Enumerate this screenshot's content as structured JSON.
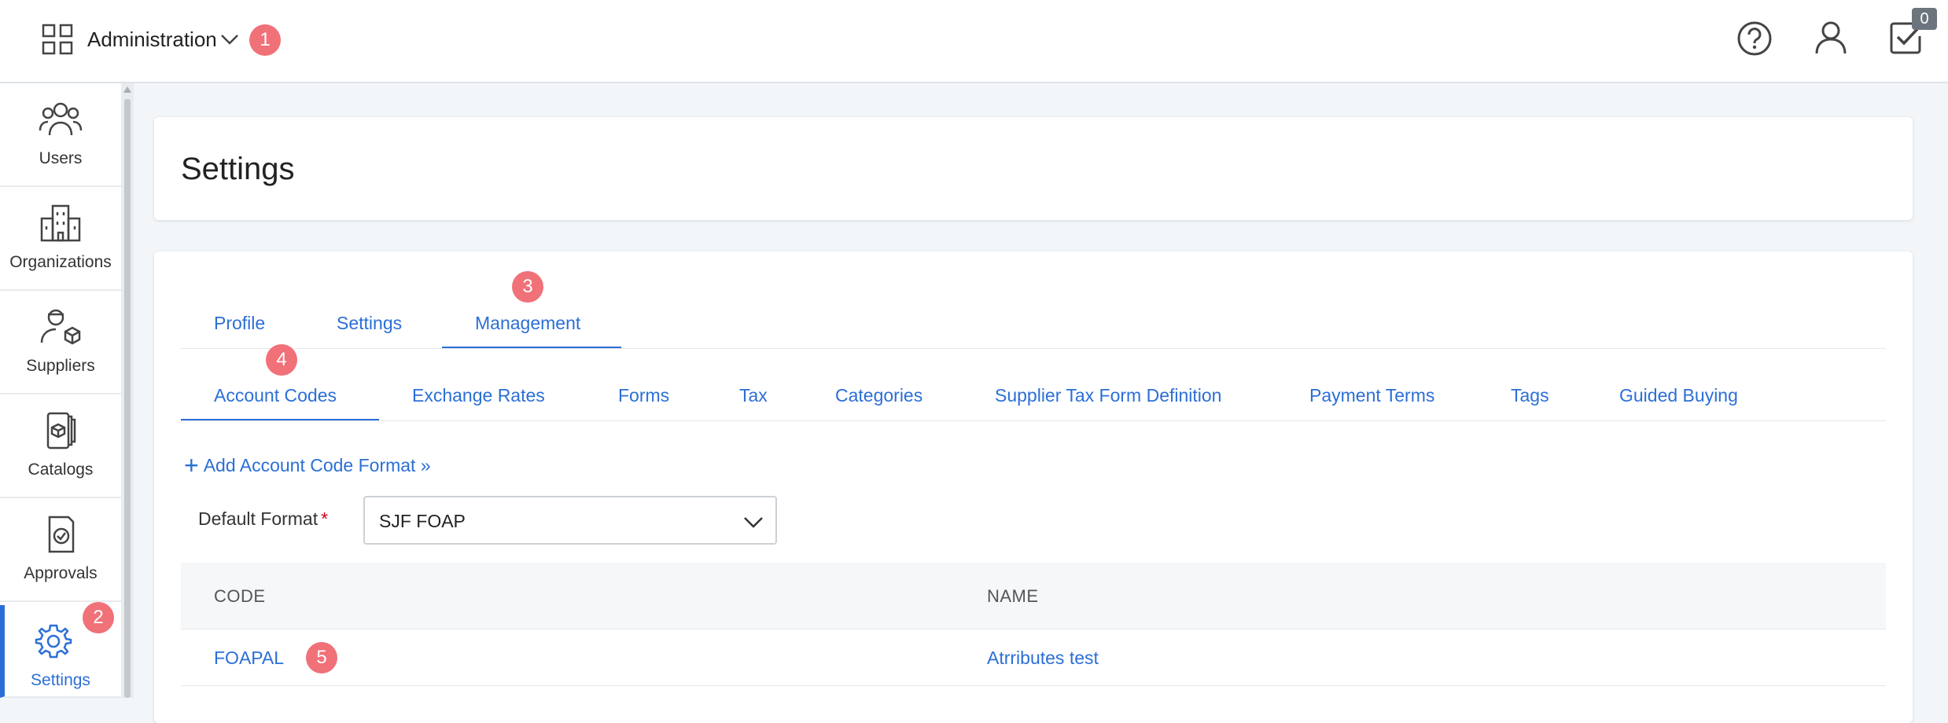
{
  "header": {
    "module_title": "Administration",
    "tasks_count": "0",
    "icons": [
      "grid-icon",
      "chevron-down-icon",
      "help-icon",
      "user-icon",
      "tasks-icon"
    ]
  },
  "badges": [
    "1",
    "2",
    "3",
    "4",
    "5"
  ],
  "sidebar": {
    "items": [
      {
        "label": "Users",
        "icon": "users-icon"
      },
      {
        "label": "Organizations",
        "icon": "building-icon"
      },
      {
        "label": "Suppliers",
        "icon": "supplier-icon"
      },
      {
        "label": "Catalogs",
        "icon": "catalog-icon"
      },
      {
        "label": "Approvals",
        "icon": "approval-icon"
      },
      {
        "label": "Settings",
        "icon": "gear-icon",
        "active": true
      }
    ]
  },
  "page": {
    "title": "Settings"
  },
  "tabs": {
    "primary": [
      "Profile",
      "Settings",
      "Management"
    ],
    "primary_active": "Management",
    "secondary": [
      "Account Codes",
      "Exchange Rates",
      "Forms",
      "Tax",
      "Categories",
      "Supplier Tax Form Definition",
      "Payment Terms",
      "Tags",
      "Guided Buying"
    ],
    "secondary_active": "Account Codes"
  },
  "account_codes": {
    "add_link": "Add Account Code Format »",
    "default_format_label": "Default Format",
    "required_mark": "*",
    "default_format_value": "SJF FOAP",
    "columns": [
      "CODE",
      "NAME"
    ],
    "rows": [
      {
        "code": "FOAPAL",
        "name": "Atrributes test"
      }
    ]
  },
  "colors": {
    "accent": "#2b6fd6",
    "badge": "#f07178",
    "required": "#d0021b"
  }
}
